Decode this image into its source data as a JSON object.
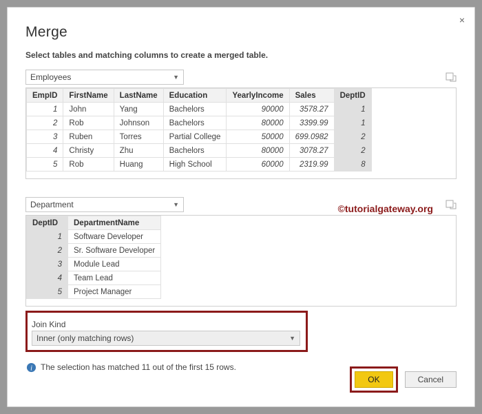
{
  "dialog": {
    "title": "Merge",
    "subtitle": "Select tables and matching columns to create a merged table.",
    "close": "×"
  },
  "primary": {
    "selected": "Employees",
    "columns": [
      "EmpID",
      "FirstName",
      "LastName",
      "Education",
      "YearlyIncome",
      "Sales",
      "DeptID"
    ],
    "rows": [
      {
        "EmpID": "1",
        "FirstName": "John",
        "LastName": "Yang",
        "Education": "Bachelors",
        "YearlyIncome": "90000",
        "Sales": "3578.27",
        "DeptID": "1"
      },
      {
        "EmpID": "2",
        "FirstName": "Rob",
        "LastName": "Johnson",
        "Education": "Bachelors",
        "YearlyIncome": "80000",
        "Sales": "3399.99",
        "DeptID": "1"
      },
      {
        "EmpID": "3",
        "FirstName": "Ruben",
        "LastName": "Torres",
        "Education": "Partial College",
        "YearlyIncome": "50000",
        "Sales": "699.0982",
        "DeptID": "2"
      },
      {
        "EmpID": "4",
        "FirstName": "Christy",
        "LastName": "Zhu",
        "Education": "Bachelors",
        "YearlyIncome": "80000",
        "Sales": "3078.27",
        "DeptID": "2"
      },
      {
        "EmpID": "5",
        "FirstName": "Rob",
        "LastName": "Huang",
        "Education": "High School",
        "YearlyIncome": "60000",
        "Sales": "2319.99",
        "DeptID": "8"
      }
    ]
  },
  "secondary": {
    "selected": "Department",
    "columns": [
      "DeptID",
      "DepartmentName"
    ],
    "rows": [
      {
        "DeptID": "1",
        "DepartmentName": "Software Developer"
      },
      {
        "DeptID": "2",
        "DepartmentName": "Sr. Software Developer"
      },
      {
        "DeptID": "3",
        "DepartmentName": "Module Lead"
      },
      {
        "DeptID": "4",
        "DepartmentName": "Team Lead"
      },
      {
        "DeptID": "5",
        "DepartmentName": "Project Manager"
      }
    ]
  },
  "join": {
    "label": "Join Kind",
    "selected": "Inner (only matching rows)"
  },
  "status": "The selection has matched 11 out of the first 15 rows.",
  "buttons": {
    "ok": "OK",
    "cancel": "Cancel"
  },
  "watermark": "©tutorialgateway.org"
}
